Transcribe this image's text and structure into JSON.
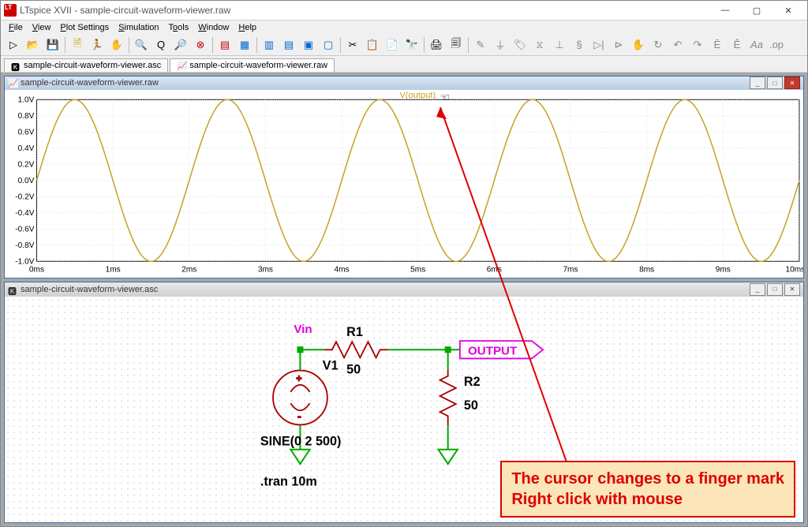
{
  "window": {
    "title": "LTspice XVII - sample-circuit-waveform-viewer.raw"
  },
  "menu": [
    "File",
    "View",
    "Plot Settings",
    "Simulation",
    "Tools",
    "Window",
    "Help"
  ],
  "tabs": [
    {
      "label": "sample-circuit-waveform-viewer.asc",
      "active": false
    },
    {
      "label": "sample-circuit-waveform-viewer.raw",
      "active": true
    }
  ],
  "waveform_child_title": "sample-circuit-waveform-viewer.raw",
  "schematic_child_title": "sample-circuit-waveform-viewer.asc",
  "trace_label": "V(output)",
  "chart_data": {
    "type": "line",
    "title": "",
    "xlabel": "",
    "ylabel": "",
    "x_ticks": [
      "0ms",
      "1ms",
      "2ms",
      "3ms",
      "4ms",
      "5ms",
      "6ms",
      "7ms",
      "8ms",
      "9ms",
      "10ms"
    ],
    "y_ticks": [
      "1.0V",
      "0.8V",
      "0.6V",
      "0.4V",
      "0.2V",
      "0.0V",
      "-0.2V",
      "-0.4V",
      "-0.6V",
      "-0.8V",
      "-1.0V"
    ],
    "xlim": [
      0,
      10
    ],
    "ylim": [
      -1.0,
      1.0
    ],
    "series": [
      {
        "name": "V(output)",
        "function": "1.0*sin(2*pi*500*t)",
        "amplitude": 1.0,
        "frequency_hz": 500,
        "color": "#c9a227"
      }
    ]
  },
  "schematic": {
    "net_label": "Vin",
    "v1": {
      "name": "V1",
      "value": "SINE(0 2 500)"
    },
    "r1": {
      "name": "R1",
      "value": "50"
    },
    "r2": {
      "name": "R2",
      "value": "50"
    },
    "output_label": "OUTPUT",
    "directive": ".tran 10m"
  },
  "annotation": {
    "line1": "The cursor changes to a finger mark",
    "line2": "Right click with mouse"
  }
}
